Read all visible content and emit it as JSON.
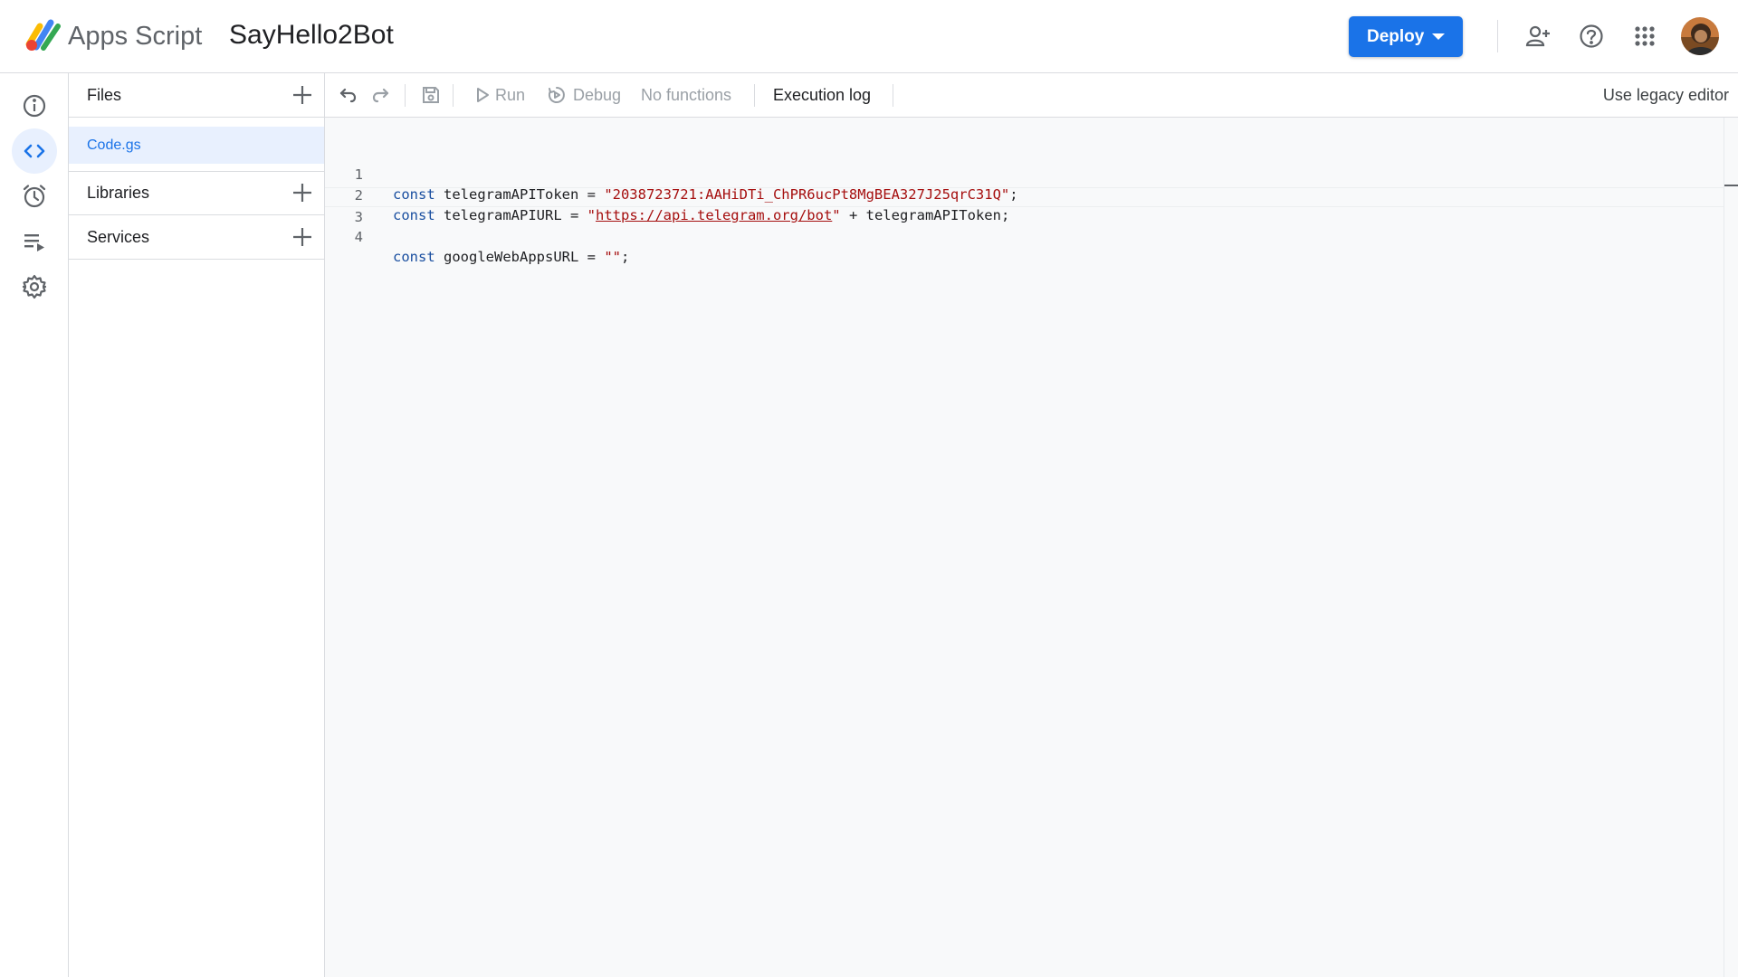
{
  "header": {
    "app_name": "Apps Script",
    "project_title": "SayHello2Bot",
    "deploy_label": "Deploy"
  },
  "rail": {
    "items": [
      {
        "name": "overview",
        "icon": "info-icon"
      },
      {
        "name": "editor",
        "icon": "code-icon",
        "active": true
      },
      {
        "name": "triggers",
        "icon": "alarm-clock-icon"
      },
      {
        "name": "executions",
        "icon": "executions-list-icon"
      },
      {
        "name": "project-settings",
        "icon": "gear-icon"
      }
    ]
  },
  "files_panel": {
    "files_label": "Files",
    "files": [
      {
        "name": "Code.gs"
      }
    ],
    "libraries_label": "Libraries",
    "services_label": "Services"
  },
  "toolbar": {
    "run_label": "Run",
    "debug_label": "Debug",
    "function_select": "No functions",
    "execution_log_label": "Execution log",
    "legacy_label": "Use legacy editor"
  },
  "editor": {
    "lines": [
      {
        "number": "1",
        "kw": "const",
        "name": " telegramAPIToken = ",
        "str": "\"2038723721:AAHiDTi_ChPR6ucPt8MgBEA327J25qrC31Q\"",
        "tail": ";"
      },
      {
        "number": "2",
        "kw": "const",
        "name": " telegramAPIURL = ",
        "quote_open": "\"",
        "url": "https://api.telegram.org/bot",
        "quote_close": "\"",
        "tail": " + telegramAPIToken;"
      },
      {
        "number": "3"
      },
      {
        "number": "4",
        "kw": "const",
        "name": " googleWebAppsURL = ",
        "str": "\"\"",
        "tail": ";"
      }
    ]
  },
  "colors": {
    "accent": "#1a73e8",
    "keyword": "#1a4fa0",
    "string": "#a50e0e"
  }
}
